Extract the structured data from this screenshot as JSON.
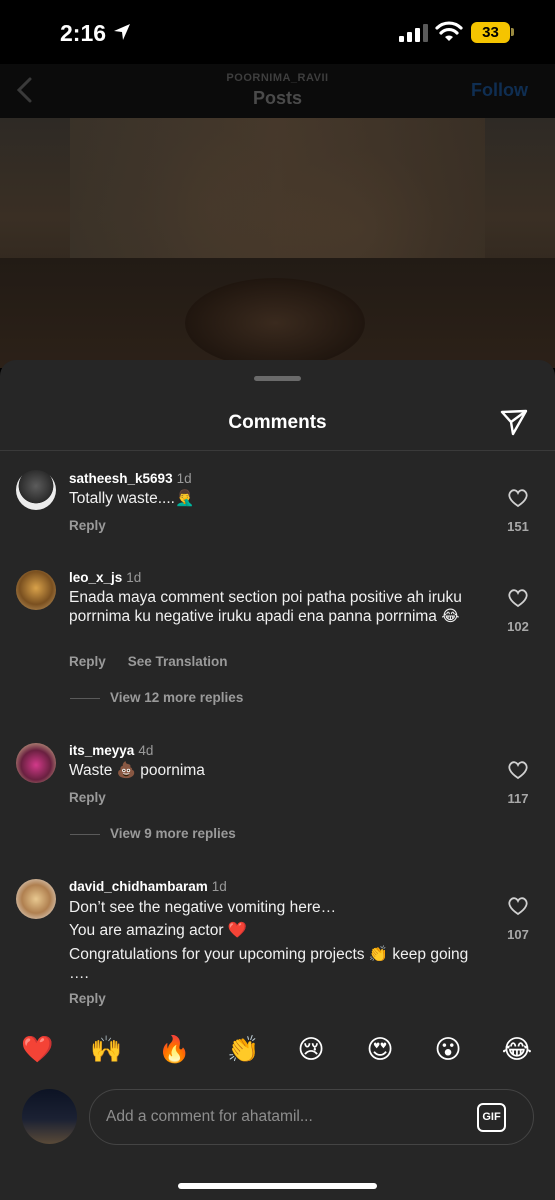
{
  "status_bar": {
    "time": "2:16",
    "battery": "33",
    "battery_color": "#f5c400"
  },
  "post_header": {
    "owner": "POORNIMA_RAVII",
    "title": "Posts",
    "follow_label": "Follow"
  },
  "sheet": {
    "title": "Comments"
  },
  "comments": [
    {
      "user": "satheesh_k5693",
      "time": "1d",
      "text": "Totally waste....🤦‍♂️",
      "reply_label": "Reply",
      "likes": "151"
    },
    {
      "user": "leo_x_js",
      "time": "1d",
      "text": "Enada maya comment section poi patha positive ah iruku porrnima ku negative iruku apadi ena panna porrnima 😂",
      "reply_label": "Reply",
      "translate_label": "See Translation",
      "likes": "102",
      "more_replies": "View 12 more replies"
    },
    {
      "user": "its_meyya",
      "time": "4d",
      "text": "Waste 💩 poornima",
      "reply_label": "Reply",
      "likes": "117",
      "more_replies": "View 9 more replies"
    },
    {
      "user": "david_chidhambaram",
      "time": "1d",
      "text_lines": [
        "Don’t see the negative vomiting here…",
        "You are amazing actor ❤️",
        "Congratulations for your upcoming projects 👏 keep going …."
      ],
      "reply_label": "Reply",
      "likes": "107"
    }
  ],
  "emoji_bar": [
    "❤️",
    "🙌",
    "🔥",
    "👏",
    "😢",
    "😍",
    "😮",
    "😂"
  ],
  "input": {
    "placeholder": "Add a comment for ahatamil...",
    "gif_label": "GIF"
  }
}
